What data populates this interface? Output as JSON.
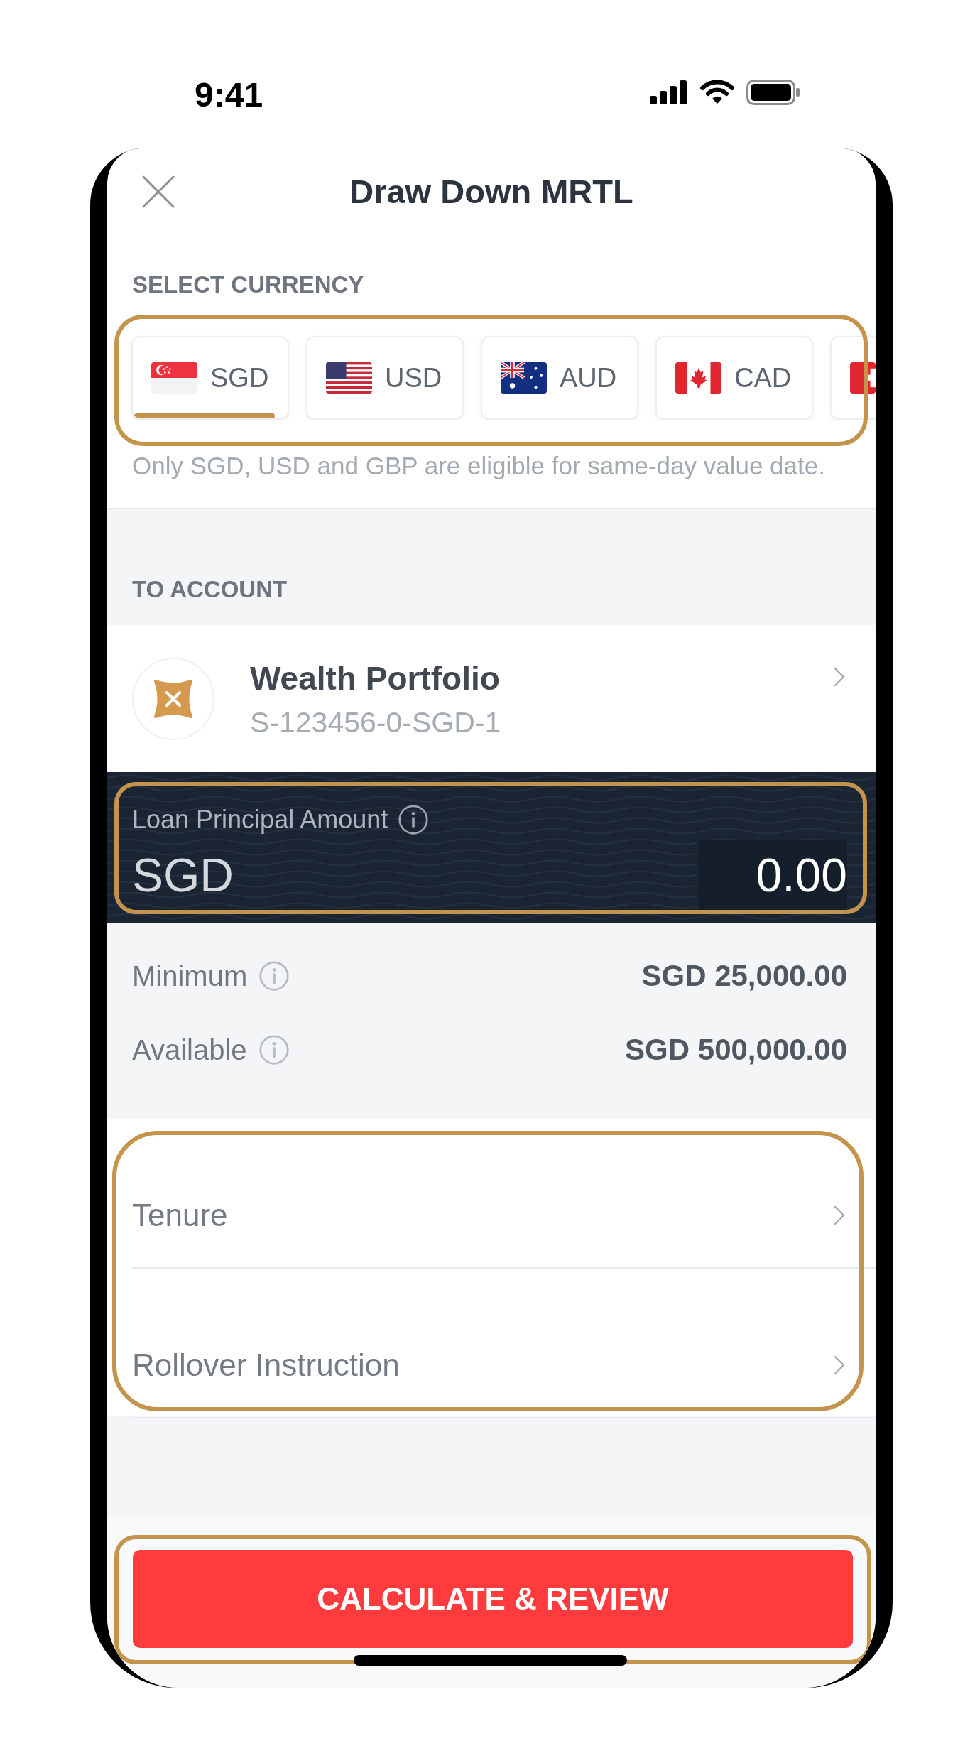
{
  "status_bar": {
    "time": "9:41"
  },
  "header": {
    "title": "Draw Down MRTL"
  },
  "currency": {
    "label": "SELECT CURRENCY",
    "highlighted": true,
    "tabs": [
      {
        "label": "SGD",
        "kind": "singapore",
        "selected": true
      },
      {
        "label": "USD",
        "kind": "usa",
        "selected": false
      },
      {
        "label": "AUD",
        "kind": "australia",
        "selected": false
      },
      {
        "label": "CAD",
        "kind": "canada",
        "selected": false
      },
      {
        "kind": "switzerland",
        "selected": false
      }
    ],
    "note": "Only SGD, USD and GBP are eligible for same-day value date."
  },
  "to_account": {
    "label": "TO ACCOUNT",
    "name": "Wealth Portfolio",
    "number": "S-123456-0-SGD-1"
  },
  "loan_principal": {
    "label": "Loan Principal Amount",
    "currency": "SGD",
    "value": "0.00",
    "highlighted": true
  },
  "limits": [
    {
      "label": "Minimum",
      "value": "SGD 25,000.00"
    },
    {
      "label": "Available",
      "value": "SGD 500,000.00"
    }
  ],
  "options": {
    "highlighted": true,
    "items": [
      {
        "label": "Tenure"
      },
      {
        "label": "Rollover Instruction"
      }
    ]
  },
  "primary_button": {
    "label": "CALCULATE & REVIEW",
    "highlighted": true
  }
}
